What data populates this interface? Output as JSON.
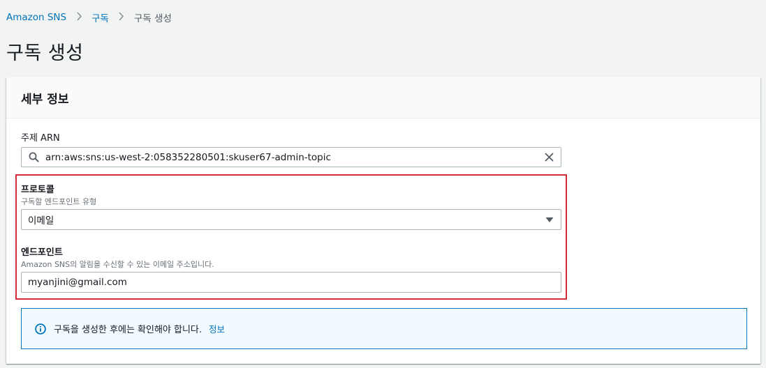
{
  "breadcrumb": {
    "items": [
      "Amazon SNS",
      "구독",
      "구독 생성"
    ]
  },
  "page": {
    "title": "구독 생성"
  },
  "details_panel": {
    "title": "세부 정보",
    "topic_arn": {
      "label": "주제 ARN",
      "value": "arn:aws:sns:us-west-2:058352280501:skuser67-admin-topic"
    },
    "protocol": {
      "label": "프로토콜",
      "description": "구독할 엔드포인트 유형",
      "selected": "이메일"
    },
    "endpoint": {
      "label": "엔드포인트",
      "description": "Amazon SNS의 알림을 수신할 수 있는 이메일 주소입니다.",
      "value": "myanjini@gmail.com"
    },
    "alert": {
      "text": "구독을 생성한 후에는 확인해야 합니다.",
      "link": "정보"
    }
  },
  "colors": {
    "link": "#0073bb",
    "highlight_border": "#d72a38",
    "alert_bg": "#f1faff",
    "alert_border": "#0073bb"
  },
  "icons": {
    "breadcrumb_separator": "chevron-right-icon",
    "search": "search-icon",
    "clear": "close-icon",
    "dropdown": "caret-down-icon",
    "info": "info-icon"
  }
}
